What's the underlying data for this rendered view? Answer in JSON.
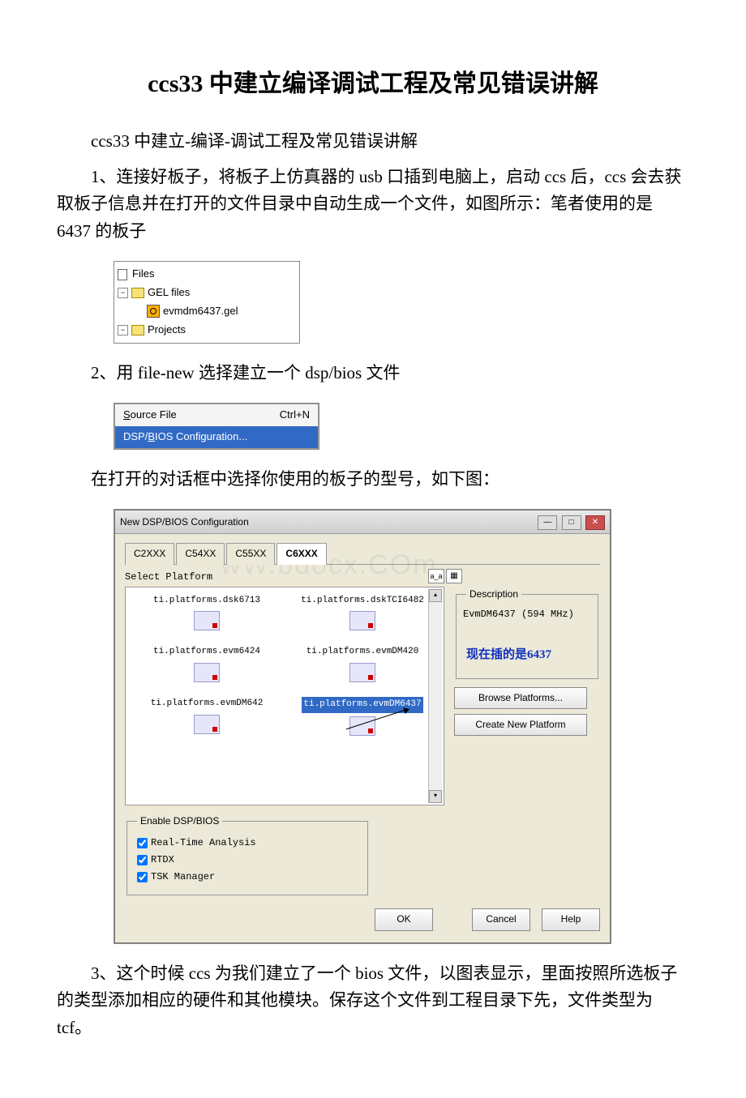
{
  "title": "ccs33 中建立编译调试工程及常见错误讲解",
  "p1": "ccs33 中建立-编译-调试工程及常见错误讲解",
  "p2": "1、连接好板子，将板子上仿真器的 usb 口插到电脑上，启动 ccs 后，ccs 会去获取板子信息并在打开的文件目录中自动生成一个文件，如图所示：笔者使用的是 6437 的板子",
  "tree": {
    "root": "Files",
    "gel": "GEL files",
    "gel_item": "evmdm6437.gel",
    "projects": "Projects"
  },
  "p3": "2、用 file-new 选择建立一个 dsp/bios 文件",
  "menu": {
    "item1": "Source File",
    "shortcut1": "Ctrl+N",
    "item2": "DSP/BIOS Configuration..."
  },
  "p4": "在打开的对话框中选择你使用的板子的型号，如下图：",
  "dlg": {
    "title": "New DSP/BIOS Configuration",
    "tabs": [
      "C2XXX",
      "C54XX",
      "C55XX",
      "C6XXX"
    ],
    "active_tab": 3,
    "select_label": "Select Platform",
    "platforms": [
      "ti.platforms.dsk6713",
      "ti.platforms.dskTCI6482",
      "ti.platforms.evm6424",
      "ti.platforms.evmDM420",
      "ti.platforms.evmDM642",
      "ti.platforms.evmDM6437"
    ],
    "selected": 5,
    "desc_label": "Description",
    "desc_text": "EvmDM6437 (594 MHz)",
    "note": "现在插的是6437",
    "browse_btn": "Browse Platforms...",
    "create_btn": "Create New Platform",
    "group_label": "Enable DSP/BIOS",
    "chk1": "Real-Time Analysis",
    "chk2": "RTDX",
    "chk3": "TSK Manager",
    "ok": "OK",
    "cancel": "Cancel",
    "help": "Help"
  },
  "p5": "3、这个时候 ccs 为我们建立了一个 bios 文件，以图表显示，里面按照所选板子的类型添加相应的硬件和其他模块。保存这个文件到工程目录下先，文件类型为 tcf。",
  "watermark": "wW.bdocx.COm"
}
